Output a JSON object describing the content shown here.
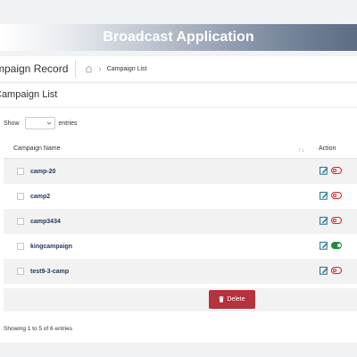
{
  "app": {
    "title": "Broadcast Application"
  },
  "header": {
    "page_title": "mpaign Record",
    "breadcrumb": "Campaign List"
  },
  "card": {
    "title": "Campaign List",
    "show_label": "Show",
    "entries_label": "entries",
    "page_size": "",
    "columns": {
      "name": "Campaign Name",
      "action": "Action"
    },
    "rows": [
      {
        "name": "camp-20",
        "status": "off"
      },
      {
        "name": "camp2",
        "status": "off"
      },
      {
        "name": "camp3434",
        "status": "off"
      },
      {
        "name": "kingcampaign",
        "status": "on"
      },
      {
        "name": "test9-3-camp",
        "status": "off"
      }
    ],
    "delete_label": "Delete",
    "info": "Showing 1 to 5 of 6 entries"
  },
  "colors": {
    "accent": "#1f6f8b",
    "delete": "#b5323e",
    "toggle_off": "#d9232d",
    "toggle_on": "#1e8e3e"
  }
}
